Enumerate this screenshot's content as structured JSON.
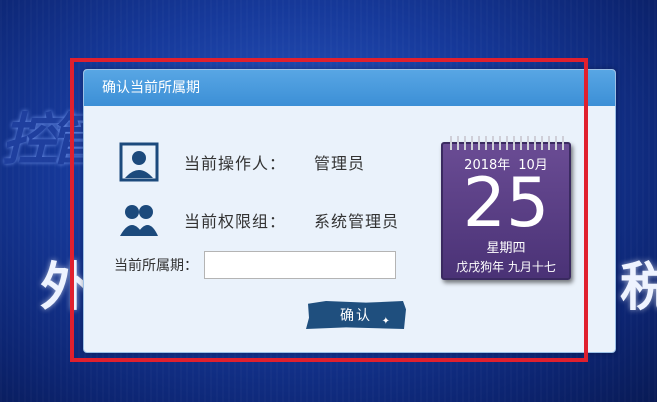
{
  "dialog": {
    "title": "确认当前所属期",
    "operator_label": "当前操作人：",
    "operator_value": "管理员",
    "permission_label": "当前权限组：",
    "permission_value": "系统管理员",
    "period_label": "当前所属期：",
    "period_value": "",
    "confirm_label": "确认",
    "icons": [
      "user-icon",
      "group-icon"
    ]
  },
  "calendar": {
    "year": "2018年",
    "month": "10月",
    "day": "25",
    "weekday": "星期四",
    "lunar": "戊戌狗年  九月十七"
  },
  "background": {
    "chars": [
      "控",
      "管",
      "外",
      "税"
    ]
  },
  "colors": {
    "header": "#4599dc",
    "highlight_frame": "#e0202e",
    "button": "#1f4f7e",
    "calendar": "#5a3f86"
  }
}
